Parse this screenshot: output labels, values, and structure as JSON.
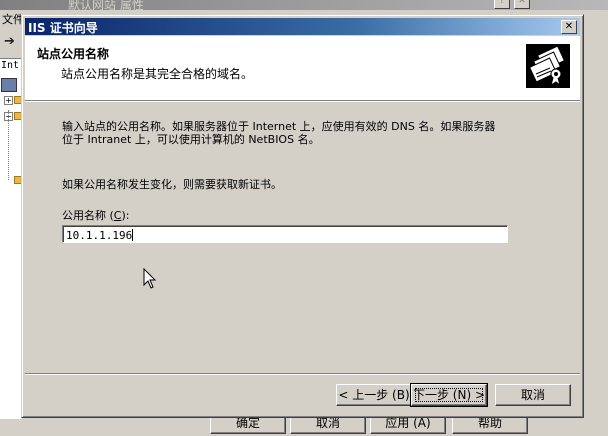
{
  "background_window": {
    "title": "默认网站 属性",
    "menu_file": "文件",
    "tree_label": "Int",
    "buttons": {
      "ok": "确定",
      "cancel": "取消",
      "apply": "应用 (A)",
      "help": "帮助"
    }
  },
  "dialog": {
    "title": "IIS 证书向导",
    "close_glyph": "✕",
    "header": {
      "title": "站点公用名称",
      "subtitle": "站点公用名称是其完全合格的域名。"
    },
    "paragraph1": "输入站点的公用名称。如果服务器位于 Internet 上，应使用有效的 DNS 名。如果服务器\n位于 Intranet 上，可以使用计算机的 NetBIOS 名。",
    "paragraph2": "如果公用名称发生变化，则需要获取新证书。",
    "field": {
      "label_prefix": "公用名称 (",
      "label_accel": "C",
      "label_suffix": "):",
      "value": "10.1.1.196"
    },
    "buttons": {
      "back": "< 上一步 (B)",
      "next": "下一步 (N) >",
      "cancel": "取消"
    }
  },
  "colors": {
    "titlebar_start": "#0a246a",
    "titlebar_end": "#a6caf0",
    "face": "#d4d0c8"
  }
}
